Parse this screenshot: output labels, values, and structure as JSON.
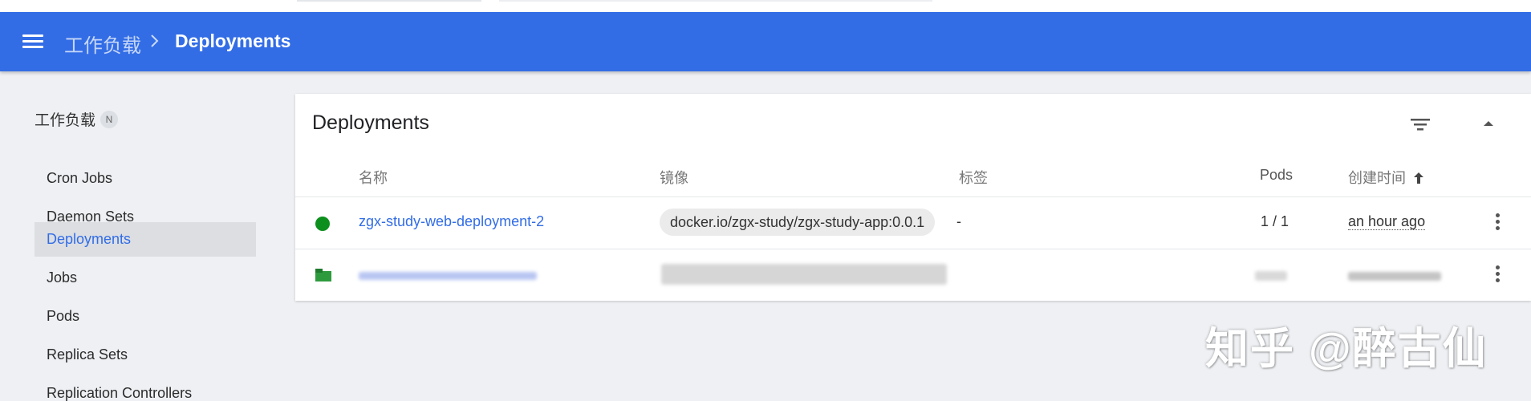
{
  "colors": {
    "toolbar": "#326de6",
    "link": "#326de6",
    "status_running": "#0d8f1e",
    "active_nav_bg": "#dcdee2"
  },
  "toolbar": {
    "menu_icon": "menu-icon",
    "breadcrumb_parent": "工作负载",
    "breadcrumb_separator_icon": "chevron-right-icon",
    "breadcrumb_current": "Deployments"
  },
  "sidebar": {
    "section_label": "工作负载",
    "section_badge": "N",
    "items": [
      {
        "label": "Cron Jobs",
        "active": false
      },
      {
        "label": "Daemon Sets",
        "active": false
      },
      {
        "label": "Deployments",
        "active": true
      },
      {
        "label": "Jobs",
        "active": false
      },
      {
        "label": "Pods",
        "active": false
      },
      {
        "label": "Replica Sets",
        "active": false
      },
      {
        "label": "Replication Controllers",
        "active": false
      }
    ]
  },
  "card": {
    "title": "Deployments",
    "filter_icon": "filter-icon",
    "collapse_icon": "expand-less-icon",
    "columns": {
      "name": "名称",
      "image": "镜像",
      "labels": "标签",
      "pods": "Pods",
      "created": "创建时间"
    },
    "sort_icon": "arrow-upward-icon",
    "rows": [
      {
        "status": "running",
        "name": "zgx-study-web-deployment-2",
        "image": "docker.io/zgx-study/zgx-study-app:0.0.1",
        "labels": "-",
        "pods": "1 / 1",
        "created": "an hour ago",
        "actions_icon": "more-vert-icon"
      },
      {
        "status": "blurred",
        "actions_icon": "more-vert-icon"
      }
    ]
  },
  "watermark": "知乎 @醉古仙"
}
